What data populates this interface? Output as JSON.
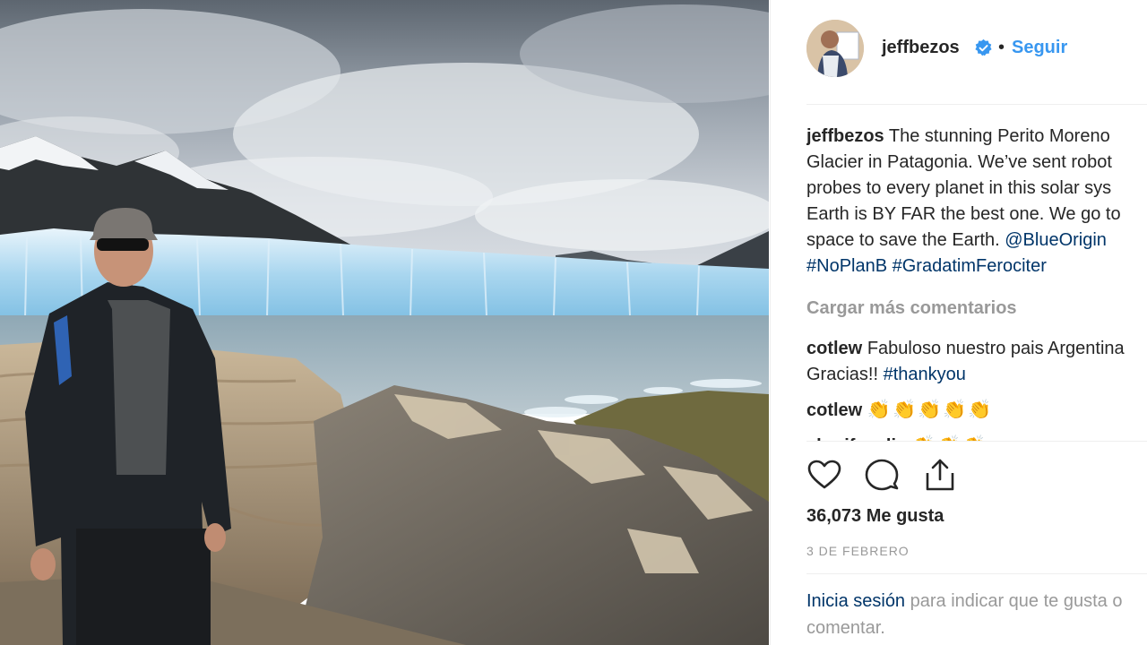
{
  "post": {
    "username": "jeffbezos",
    "follow_label": "Seguir",
    "separator": "•",
    "caption": {
      "author": "jeffbezos",
      "text": "The stunning Perito Moreno\nGlacier in Patagonia. We’ve sent robot\nprobes to every planet in this solar sys\nEarth is BY FAR the best one. We go to\nspace to save the Earth. ",
      "mention": "@BlueOrigin",
      "hashtag_1": "#NoPlanB",
      "hashtag_2": "#GradatimFerociter"
    },
    "load_more_label": "Cargar más comentarios",
    "comments": [
      {
        "author": "cotlew",
        "text": "Fabuloso nuestro pais Argentina\nGracias!! ",
        "hashtag": "#thankyou"
      },
      {
        "author": "cotlew",
        "text": "👏👏👏👏👏"
      },
      {
        "author": "sherifvaglio",
        "text": "👏👏👏"
      }
    ],
    "likes_label": "36,073 Me gusta",
    "date_label": "3 DE FEBRERO",
    "login": {
      "link_label": "Inicia sesión",
      "rest_text": "para indicar que te gusta o comentar."
    }
  },
  "icons": [
    "heart-icon",
    "comment-icon",
    "share-icon",
    "verified-badge-icon"
  ],
  "colors": {
    "link_blue": "#3897f0",
    "link_dark": "#003569",
    "muted": "#999999",
    "text": "#262626"
  }
}
